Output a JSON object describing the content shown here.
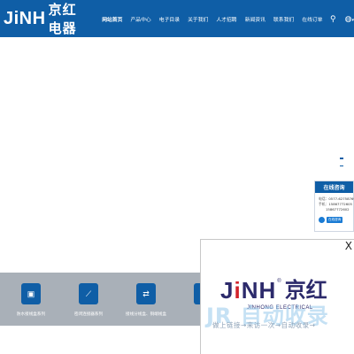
{
  "header": {
    "logo_latin": "JiNH",
    "logo_cn": "京红电器",
    "nav": [
      {
        "label": "网站首页",
        "active": true
      },
      {
        "label": "产品中心",
        "active": false
      },
      {
        "label": "电子目录",
        "active": false
      },
      {
        "label": "关于我们",
        "active": false
      },
      {
        "label": "人才招聘",
        "active": false
      },
      {
        "label": "新闻资讯",
        "active": false
      },
      {
        "label": "联系我们",
        "active": false
      },
      {
        "label": "在线订单",
        "active": false
      }
    ],
    "search_icon": "⚲",
    "globe_icon": "◍",
    "chevron": "▾"
  },
  "consult": {
    "title": "在线咨询",
    "phone_key": "电话：",
    "phone": "0577-62758769",
    "mobile_key": "手机：",
    "mobile_1": "15867772605",
    "mobile_2": "15867772602",
    "btn_label": "在线咨询"
  },
  "categories": [
    {
      "label": "防水接线盒系列",
      "icon": "▣"
    },
    {
      "label": "密闭连接器系列",
      "icon": "⟋"
    },
    {
      "label": "接线分线盒、铜端线盒",
      "icon": "⇄"
    }
  ],
  "popup": {
    "close": "X",
    "logo_ji": "J",
    "logo_i": "i",
    "logo_nh": "NH",
    "reg": "®",
    "logo_cn": "京红",
    "logo_en": "JINHONG ELECTRICAL",
    "watermark_big": "JR 自动收录",
    "watermark_small": "做上链接→来访一次→自动收录→"
  },
  "colors": {
    "brand_blue": "#0f5ea6",
    "band_gray": "#a9b0b8",
    "logo_navy": "#2c2a6b",
    "logo_red": "#d2232a"
  }
}
